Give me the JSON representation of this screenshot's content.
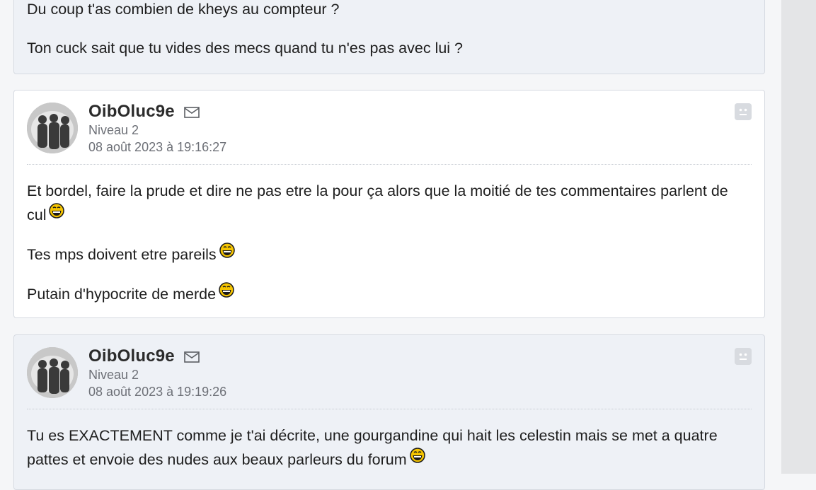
{
  "posts": [
    {
      "paragraphs": [
        "Du coup t'as combien de kheys au compteur ?",
        "Ton cuck sait que tu vides des mecs quand tu n'es pas avec lui ?"
      ]
    },
    {
      "author": "OibOluc9e",
      "level": "Niveau 2",
      "date": "08 août 2023 à 19:16:27",
      "paragraphs": [
        "Et bordel, faire la prude et dire ne pas etre la pour ça alors que la moitié de tes commentaires parlent de cul",
        "Tes mps doivent etre pareils",
        "Putain d'hypocrite de merde"
      ]
    },
    {
      "author": "OibOluc9e",
      "level": "Niveau 2",
      "date": "08 août 2023 à 19:19:26",
      "paragraphs": [
        "Tu es EXACTEMENT comme je t'ai décrite, une gourgandine qui hait les celestin mais se met a quatre pattes et envoie des nudes aux beaux parleurs du forum"
      ]
    }
  ],
  "icons": {
    "mail": "mail-icon",
    "report": "report-icon",
    "smiley": "laughing-smiley-icon"
  },
  "colors": {
    "post_alt_bg": "#eef1f6",
    "post_white_bg": "#ffffff",
    "meta_text": "#6d7077"
  }
}
